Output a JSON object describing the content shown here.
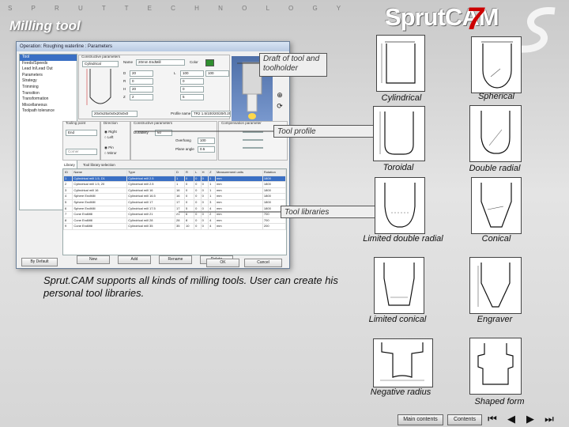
{
  "header": {
    "brand": "S P R U T   T E C H N O L O G Y",
    "title": "Milling tool",
    "logo": "SprutCAM",
    "logo_version": "7"
  },
  "dialog": {
    "title": "Operation: Roughing waterline : Parameters",
    "tree": [
      "Tool",
      "Feeds/Speeds",
      "Lead In/Lead Out",
      "Parameters",
      "Strategy",
      "Trimming",
      "Transition",
      "Transformation",
      "Miscellaneous",
      "Toolpath tolerance"
    ],
    "groups": {
      "constructive": "Constructive parameters",
      "tool_point": "Tooling point",
      "direction": "Direction",
      "constructive2": "Constructive parameters",
      "compensation": "Compensation parameter",
      "library": "Library"
    },
    "fields": {
      "type": "Cylindrical",
      "name_label": "Name",
      "name": "20mm EndMill",
      "color_label": "Color",
      "profile_label": "Profile name",
      "profile": "TR2 1.5/100/20/20/0.25",
      "tool_id": "20x0x25x0x0x20x0x0",
      "d_label": "D",
      "d": "20",
      "l_label": "L",
      "l": "100",
      "h_label": "H",
      "h": "20",
      "r_label": "R",
      "r": "0",
      "z_label": "Z",
      "z": "2",
      "f1": "0",
      "f2": "0",
      "f3": "5",
      "f4": "100",
      "tooling_point": "End",
      "dir_right": "Right",
      "dir_left": "Left",
      "tilt": "Pin",
      "tilt2": "Mirror",
      "corner": "Corner",
      "durability_label": "Durability",
      "durability": "60",
      "overhang_label": "Overhang",
      "overhang": "100",
      "plane_angle_label": "Plane angle",
      "plane_angle": "0.5"
    },
    "lib_tabs": [
      "Library",
      "Tool library selection"
    ],
    "lib_columns": [
      "ID",
      "Name",
      "Type",
      "D",
      "R",
      "L",
      "H",
      "Z",
      "Measurement units",
      "Rotation"
    ],
    "lib_rows": [
      [
        "1",
        "Cylindrical mill 1.5, D1",
        "Cylindrical mill 2.5",
        "1",
        "0",
        "0",
        "0",
        "1",
        "mm",
        "1800"
      ],
      [
        "2",
        "Cylindrical mill 1.5, 20",
        "Cylindrical mill 2.5",
        "1",
        "0",
        "0",
        "0",
        "1",
        "mm",
        "1800"
      ],
      [
        "3",
        "Cylindrical mill 16",
        "Cylindrical mill 16",
        "16",
        "0",
        "0",
        "0",
        "1",
        "mm",
        "1800"
      ],
      [
        "4",
        "Sphere EndMill",
        "Cylindrical mill 16.5",
        "16",
        "0",
        "0",
        "0",
        "1",
        "mm",
        "1800"
      ],
      [
        "5",
        "Sphere EndMill",
        "Cylindrical mill 17",
        "17",
        "0",
        "0",
        "0",
        "3",
        "mm",
        "1800"
      ],
      [
        "6",
        "Sphere EndMill",
        "Cylindrical mill 17.5",
        "17",
        "5",
        "0",
        "0",
        "4",
        "mm",
        "1800"
      ],
      [
        "7",
        "Cone EndMill",
        "Cylindrical mill 21",
        "21",
        "6",
        "0",
        "0",
        "2",
        "mm",
        "700"
      ],
      [
        "8",
        "Cone EndMill",
        "Cylindrical mill 28",
        "28",
        "8",
        "0",
        "0",
        "4",
        "mm",
        "700"
      ],
      [
        "9",
        "Cone EndMill",
        "Cylindrical mill 35",
        "35",
        "10",
        "0",
        "0",
        "4",
        "mm",
        "200"
      ]
    ],
    "buttons": {
      "new": "New",
      "add": "Add",
      "rename": "Rename",
      "delete": "Delete",
      "default": "By Default",
      "ok": "OK",
      "cancel": "Cancel"
    }
  },
  "callouts": {
    "draft": "Draft of tool and toolholder",
    "profile": "Tool profile",
    "libraries": "Tool libraries"
  },
  "description": "Sprut.CAM supports all kinds of milling tools. User can create his personal tool libraries.",
  "tools": [
    "Cylindrical",
    "Spherical",
    "Toroidal",
    "Double radial",
    "Limited double radial",
    "Conical",
    "Limited conical",
    "Engraver",
    "Negative radius",
    "Shaped form"
  ],
  "nav": {
    "main_contents": "Main contents",
    "contents": "Contents"
  },
  "colors": {
    "title": "#ffffff",
    "logo_seven": "#cc0000",
    "selection": "#3a6fc4"
  }
}
